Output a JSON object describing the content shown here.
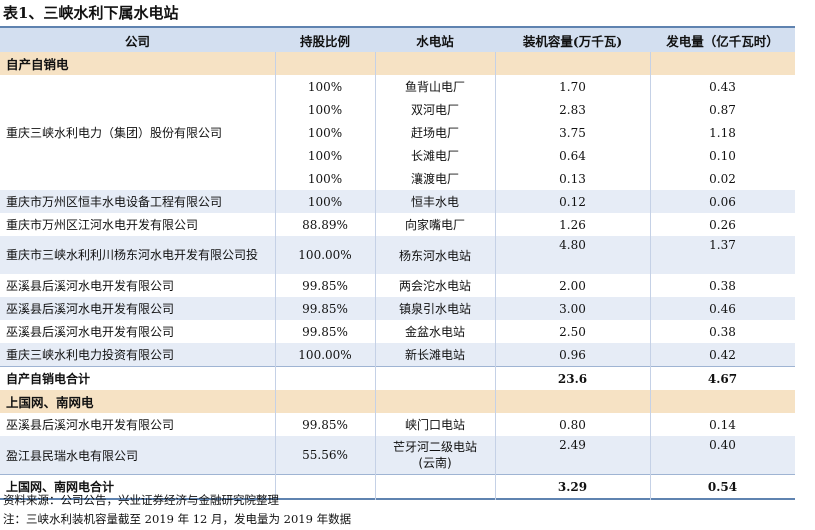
{
  "title": "表1、三峡水利下属水电站",
  "columns": [
    "公司",
    "持股比例",
    "水电站",
    "装机容量(万千瓦)",
    "发电量（亿千瓦时）"
  ],
  "sections": {
    "s1": "自产自销电",
    "s2": "上国网、南网电"
  },
  "group1": {
    "company": "重庆三峡水利电力（集团）股份有限公司",
    "rows": [
      {
        "ratio": "100%",
        "station": "鱼背山电厂",
        "capacity": "1.70",
        "generation": "0.43"
      },
      {
        "ratio": "100%",
        "station": "双河电厂",
        "capacity": "2.83",
        "generation": "0.87"
      },
      {
        "ratio": "100%",
        "station": "赶场电厂",
        "capacity": "3.75",
        "generation": "1.18"
      },
      {
        "ratio": "100%",
        "station": "长滩电厂",
        "capacity": "0.64",
        "generation": "0.10"
      },
      {
        "ratio": "100%",
        "station": "瀼渡电厂",
        "capacity": "0.13",
        "generation": "0.02"
      }
    ]
  },
  "rows1": [
    {
      "company": "重庆市万州区恒丰水电设备工程有限公司",
      "ratio": "100%",
      "station": "恒丰水电",
      "capacity": "0.12",
      "generation": "0.06"
    },
    {
      "company": "重庆市万州区江河水电开发有限公司",
      "ratio": "88.89%",
      "station": "向家嘴电厂",
      "capacity": "1.26",
      "generation": "0.26"
    },
    {
      "company": "重庆市三峡水利利川杨东河水电开发有限公司投",
      "ratio": "100.00%",
      "station": "杨东河水电站",
      "capacity": "4.80",
      "generation": "1.37"
    },
    {
      "company": "巫溪县后溪河水电开发有限公司",
      "ratio": "99.85%",
      "station": "两会沱水电站",
      "capacity": "2.00",
      "generation": "0.38"
    },
    {
      "company": "巫溪县后溪河水电开发有限公司",
      "ratio": "99.85%",
      "station": "镇泉引水电站",
      "capacity": "3.00",
      "generation": "0.46"
    },
    {
      "company": "巫溪县后溪河水电开发有限公司",
      "ratio": "99.85%",
      "station": "金盆水电站",
      "capacity": "2.50",
      "generation": "0.38"
    },
    {
      "company": "重庆三峡水利电力投资有限公司",
      "ratio": "100.00%",
      "station": "新长滩电站",
      "capacity": "0.96",
      "generation": "0.42"
    }
  ],
  "total1": {
    "label": "自产自销电合计",
    "capacity": "23.6",
    "generation": "4.67"
  },
  "rows2": [
    {
      "company": "巫溪县后溪河水电开发有限公司",
      "ratio": "99.85%",
      "station": "峡门口电站",
      "capacity": "0.80",
      "generation": "0.14"
    },
    {
      "company": "盈江县民瑞水电有限公司",
      "ratio": "55.56%",
      "station": "芒牙河二级电站(云南)",
      "capacity": "2.49",
      "generation": "0.40"
    }
  ],
  "total2": {
    "label": "上国网、南网电合计",
    "capacity": "3.29",
    "generation": "0.54"
  },
  "notes": {
    "source": "资料来源：公司公告，兴业证券经济与金融研究院整理",
    "note": "注：三峡水利装机容量截至 2019 年 12 月，发电量为 2019 年数据"
  }
}
